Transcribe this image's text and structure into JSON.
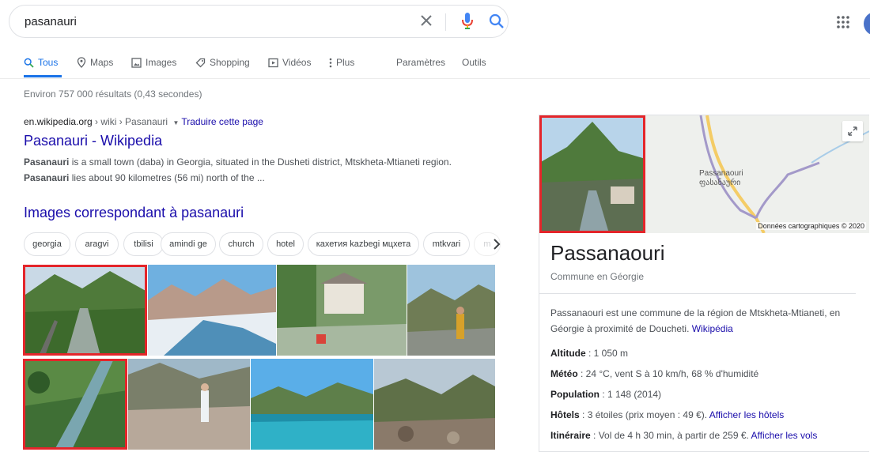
{
  "search": {
    "query": "pasanauri"
  },
  "tabs": [
    {
      "label": "Tous",
      "icon": "search-icon",
      "active": true
    },
    {
      "label": "Maps",
      "icon": "map-pin-icon"
    },
    {
      "label": "Images",
      "icon": "image-icon"
    },
    {
      "label": "Shopping",
      "icon": "tag-icon"
    },
    {
      "label": "Vidéos",
      "icon": "video-icon"
    },
    {
      "label": "Plus",
      "icon": "more-vert-icon"
    },
    {
      "label": "Paramètres"
    },
    {
      "label": "Outils"
    }
  ],
  "stats": "Environ 757 000 résultats (0,43 secondes)",
  "result": {
    "domain": "en.wikipedia.org",
    "path": " › wiki › Pasanauri",
    "translate_label": "Traduire cette page",
    "title": "Pasanauri - Wikipedia",
    "snippet_bold_1": "Pasanauri",
    "snippet_text_1": " is a small town (daba) in Georgia, situated in the Dusheti district, Mtskheta-Mtianeti region. ",
    "snippet_bold_2": "Pasanauri",
    "snippet_text_2": " lies about 90 kilometres (56 mi) north of the ..."
  },
  "images_section": {
    "heading": "Images correspondant à pasanauri",
    "chips": [
      "georgia",
      "aragvi",
      "tbilisi",
      "amindi ge",
      "church",
      "hotel",
      "кахетия kazbegi мцхета",
      "mtkvari",
      "m"
    ]
  },
  "knowledge_panel": {
    "map_label_latin": "Passanaouri",
    "map_label_georgian": "ფასანაური",
    "map_credit": "Données cartographiques © 2020",
    "title": "Passanaouri",
    "subtitle": "Commune en Géorgie",
    "description": "Passanaouri est une commune de la région de Mtskheta-Mtianeti, en Géorgie à proximité de Doucheti.",
    "description_link": "Wikipédia",
    "facts": [
      {
        "label": "Altitude",
        "value": " : 1 050 m",
        "link": ""
      },
      {
        "label": "Météo",
        "value": " : 24 °C, vent S à 10 km/h, 68 % d'humidité",
        "link": ""
      },
      {
        "label": "Population",
        "value": " : 1 148 (2014)",
        "link": ""
      },
      {
        "label": "Hôtels",
        "value": " : 3 étoiles (prix moyen : 49 €). ",
        "link": "Afficher les hôtels"
      },
      {
        "label": "Itinéraire",
        "value": " : Vol de 4 h 30 min, à partir de 259 €. ",
        "link": "Afficher les vols"
      }
    ]
  },
  "colors": {
    "link": "#1a0dab",
    "accent": "#1a73e8",
    "highlight": "#e4252a"
  }
}
